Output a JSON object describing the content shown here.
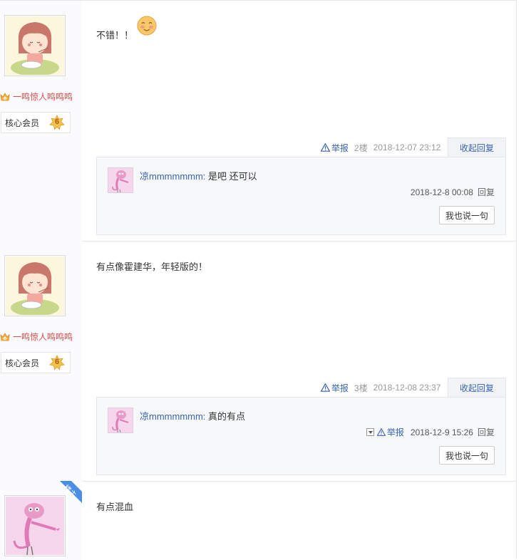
{
  "posts": [
    {
      "author": "一鸣惊人鸣鸣鸣",
      "member_label": "核心会员",
      "level": "6",
      "content": "不错！！",
      "report_label": "举报",
      "floor": "2楼",
      "time": "2018-12-07 23:12",
      "fold_label": "收起回复",
      "reply": {
        "user": "凉mmmmmmm:",
        "text": " 是吧 还可以",
        "time": "2018-12-8 00:08",
        "reply_label": "回复",
        "say_label": "我也说一句"
      }
    },
    {
      "author": "一鸣惊人鸣鸣鸣",
      "member_label": "核心会员",
      "level": "6",
      "content": "有点像霍建华，年轻版的！",
      "report_label": "举报",
      "floor": "3楼",
      "time": "2018-12-08 23:37",
      "fold_label": "收起回复",
      "reply": {
        "user": "凉mmmmmmm:",
        "text": " 真的有点",
        "report_label": "举报",
        "time": "2018-12-9 15:26",
        "reply_label": "回复",
        "say_label": "我也说一句"
      }
    },
    {
      "lz_tag": "楼主",
      "content": "有点混血"
    }
  ],
  "icons": {
    "crown": "crown-icon",
    "level": "level-star-icon",
    "report": "warning-icon",
    "emoji": "blush-emoji-icon"
  },
  "colors": {
    "link": "#3864b0",
    "username": "#e24a44",
    "lz_badge": "#4a8ee8"
  }
}
